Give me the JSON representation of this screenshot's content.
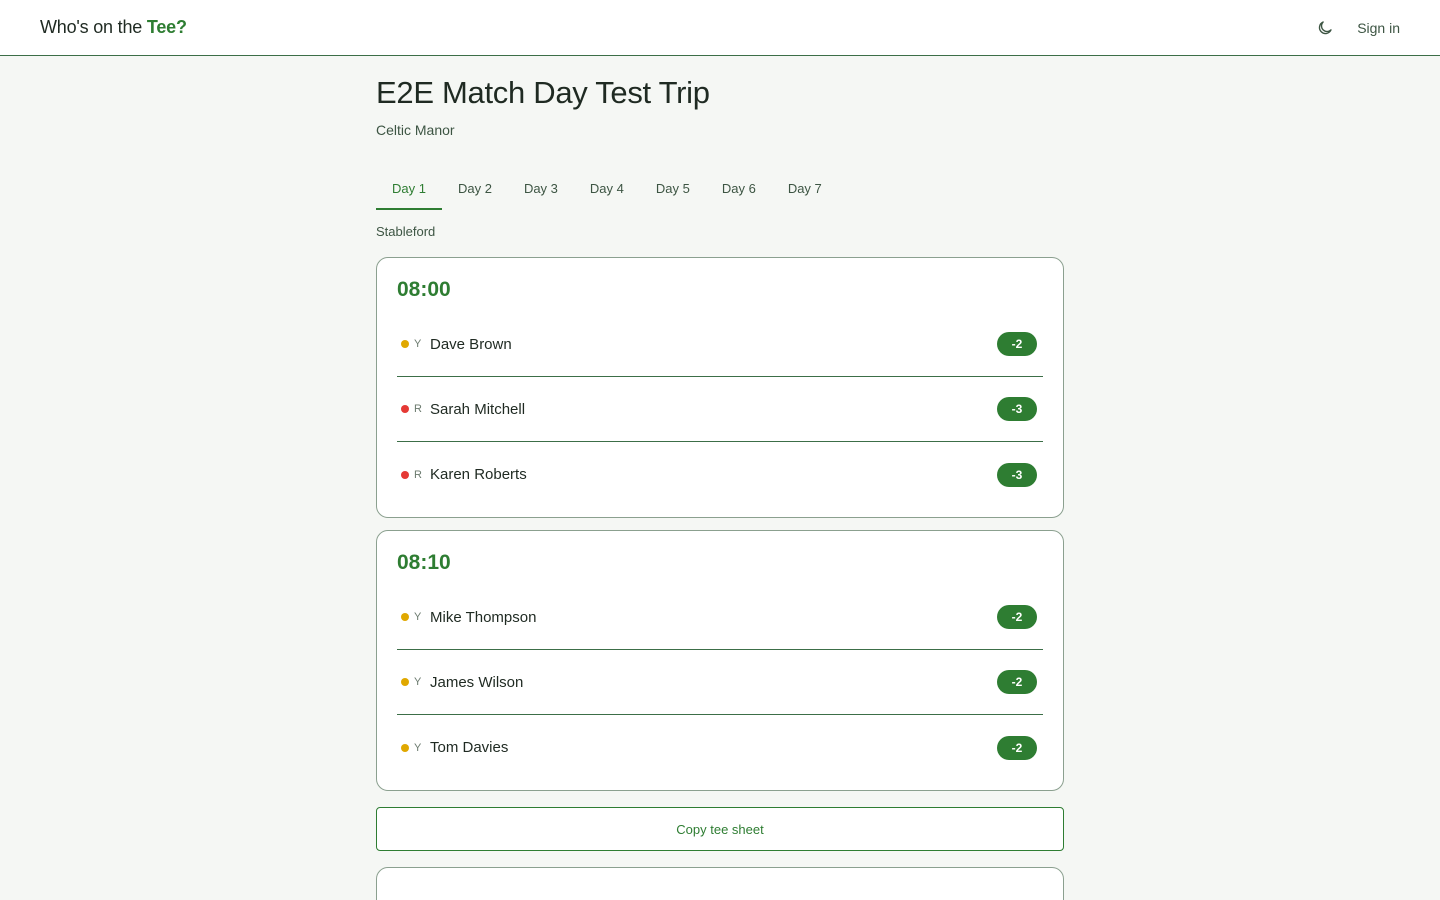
{
  "header": {
    "brand_prefix": "Who's on the ",
    "brand_accent": "Tee?",
    "theme_icon": "moon-icon",
    "signin_label": "Sign in"
  },
  "trip": {
    "title": "E2E Match Day Test Trip",
    "course": "Celtic Manor",
    "format": "Stableford"
  },
  "tabs": [
    {
      "label": "Day 1",
      "active": true
    },
    {
      "label": "Day 2",
      "active": false
    },
    {
      "label": "Day 3",
      "active": false
    },
    {
      "label": "Day 4",
      "active": false
    },
    {
      "label": "Day 5",
      "active": false
    },
    {
      "label": "Day 6",
      "active": false
    },
    {
      "label": "Day 7",
      "active": false
    }
  ],
  "colors": {
    "accent": "#2e7d32",
    "tee_yellow": "#e0a800",
    "tee_red": "#e53935"
  },
  "groups": [
    {
      "time": "08:00",
      "players": [
        {
          "tee": "Y",
          "tee_color": "#e0a800",
          "name": "Dave Brown",
          "handicap": "-2"
        },
        {
          "tee": "R",
          "tee_color": "#e53935",
          "name": "Sarah Mitchell",
          "handicap": "-3"
        },
        {
          "tee": "R",
          "tee_color": "#e53935",
          "name": "Karen Roberts",
          "handicap": "-3"
        }
      ]
    },
    {
      "time": "08:10",
      "players": [
        {
          "tee": "Y",
          "tee_color": "#e0a800",
          "name": "Mike Thompson",
          "handicap": "-2"
        },
        {
          "tee": "Y",
          "tee_color": "#e0a800",
          "name": "James Wilson",
          "handicap": "-2"
        },
        {
          "tee": "Y",
          "tee_color": "#e0a800",
          "name": "Tom Davies",
          "handicap": "-2"
        }
      ]
    }
  ],
  "actions": {
    "copy_label": "Copy tee sheet"
  }
}
